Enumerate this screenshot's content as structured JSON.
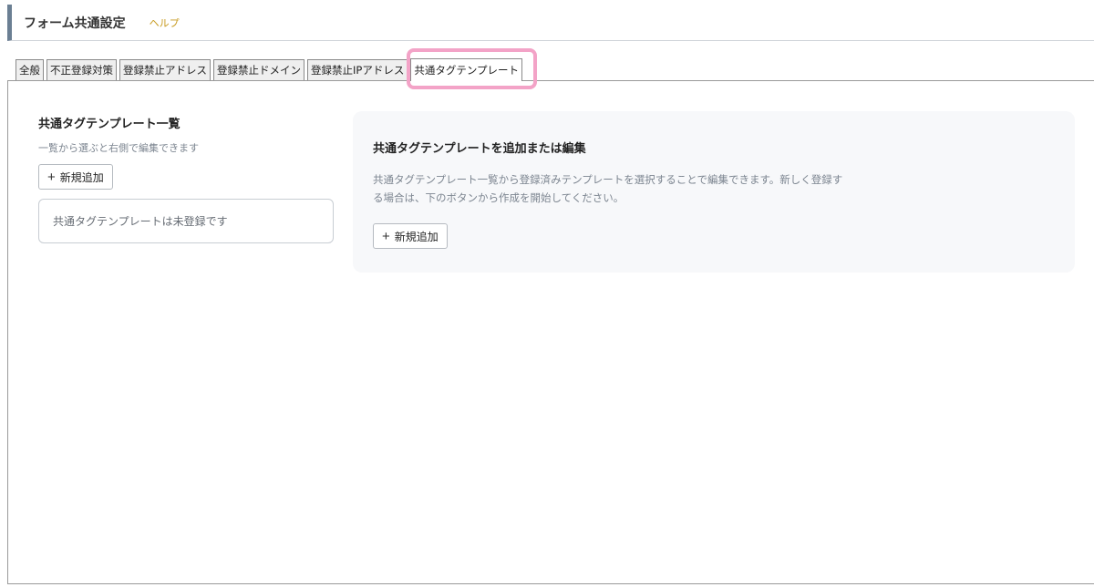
{
  "header": {
    "title": "フォーム共通設定",
    "help": "ヘルプ"
  },
  "tabs": [
    {
      "label": "全般"
    },
    {
      "label": "不正登録対策"
    },
    {
      "label": "登録禁止アドレス"
    },
    {
      "label": "登録禁止ドメイン"
    },
    {
      "label": "登録禁止IPアドレス"
    },
    {
      "label": "共通タグテンプレート"
    }
  ],
  "active_tab_index": 5,
  "highlight_color": "#f3a3c7",
  "list": {
    "title": "共通タグテンプレート一覧",
    "subtitle": "一覧から選ぶと右側で編集できます",
    "add_button": "新規追加",
    "empty_message": "共通タグテンプレートは未登録です"
  },
  "editor": {
    "title": "共通タグテンプレートを追加または編集",
    "description": "共通タグテンプレート一覧から登録済みテンプレートを選択することで編集できます。新しく登録する場合は、下のボタンから作成を開始してください。",
    "add_button": "新規追加"
  }
}
